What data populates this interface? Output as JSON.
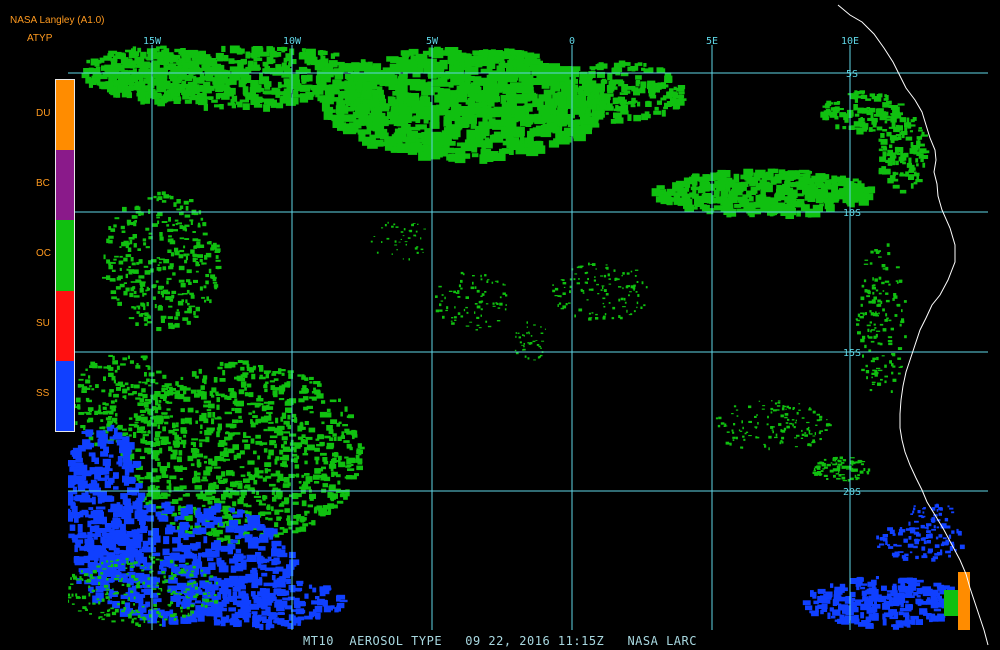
{
  "header": {
    "title": "NASA Langley (A1.0)",
    "product": "ATYP"
  },
  "legend": {
    "items": [
      {
        "label": "DU",
        "color": "#ff8c00"
      },
      {
        "label": "BC",
        "color": "#8a1a8a"
      },
      {
        "label": "OC",
        "color": "#10c010"
      },
      {
        "label": "SU",
        "color": "#ff1010"
      },
      {
        "label": "SS",
        "color": "#1040ff"
      }
    ]
  },
  "map": {
    "longitude_labels": [
      "15W",
      "10W",
      "5W",
      "0",
      "5E",
      "10E"
    ],
    "latitude_labels": [
      "5S",
      "10S",
      "15S",
      "20S"
    ],
    "grid_color": "#5fd6e6",
    "coastline_color": "#ffffff",
    "aerosol_colors": {
      "organic_carbon": "#10c010",
      "sea_salt": "#1040ff",
      "dust": "#ff8c00"
    }
  },
  "caption": "MT10  AEROSOL TYPE   09 22, 2016 11:15Z   NASA LARC"
}
